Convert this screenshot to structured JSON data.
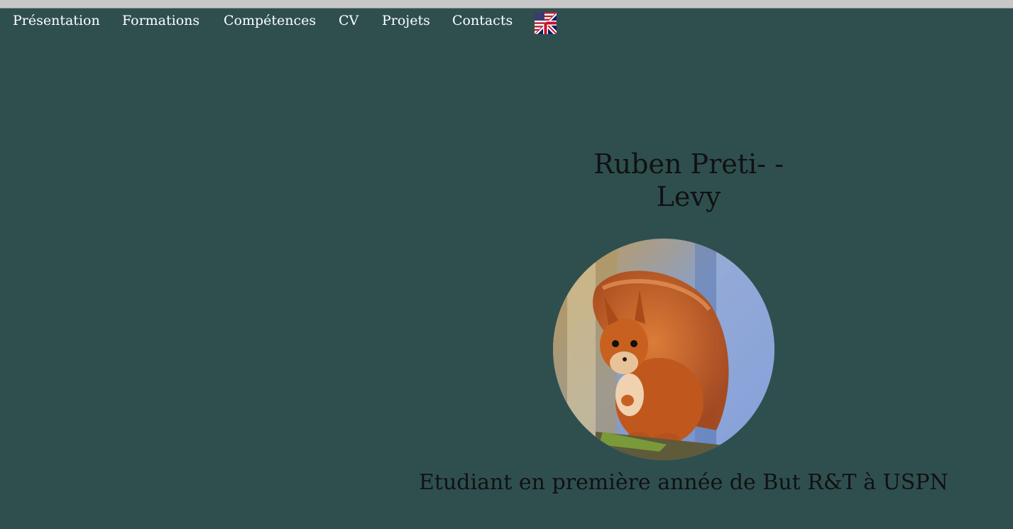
{
  "nav": {
    "items": [
      {
        "label": "Présentation"
      },
      {
        "label": "Formations"
      },
      {
        "label": "Compétences"
      },
      {
        "label": "CV"
      },
      {
        "label": "Projets"
      },
      {
        "label": "Contacts"
      }
    ],
    "language_flag_icon": "us-uk-flag-icon"
  },
  "hero": {
    "name_line1": "Ruben Preti- -",
    "name_line2": "Levy",
    "avatar_icon": "squirrel-photo",
    "subtitle": "Etudiant en première année de But R&T à USPN"
  },
  "colors": {
    "background": "#2f4f4f",
    "nav_text": "#ffffff",
    "text": "#111111"
  }
}
